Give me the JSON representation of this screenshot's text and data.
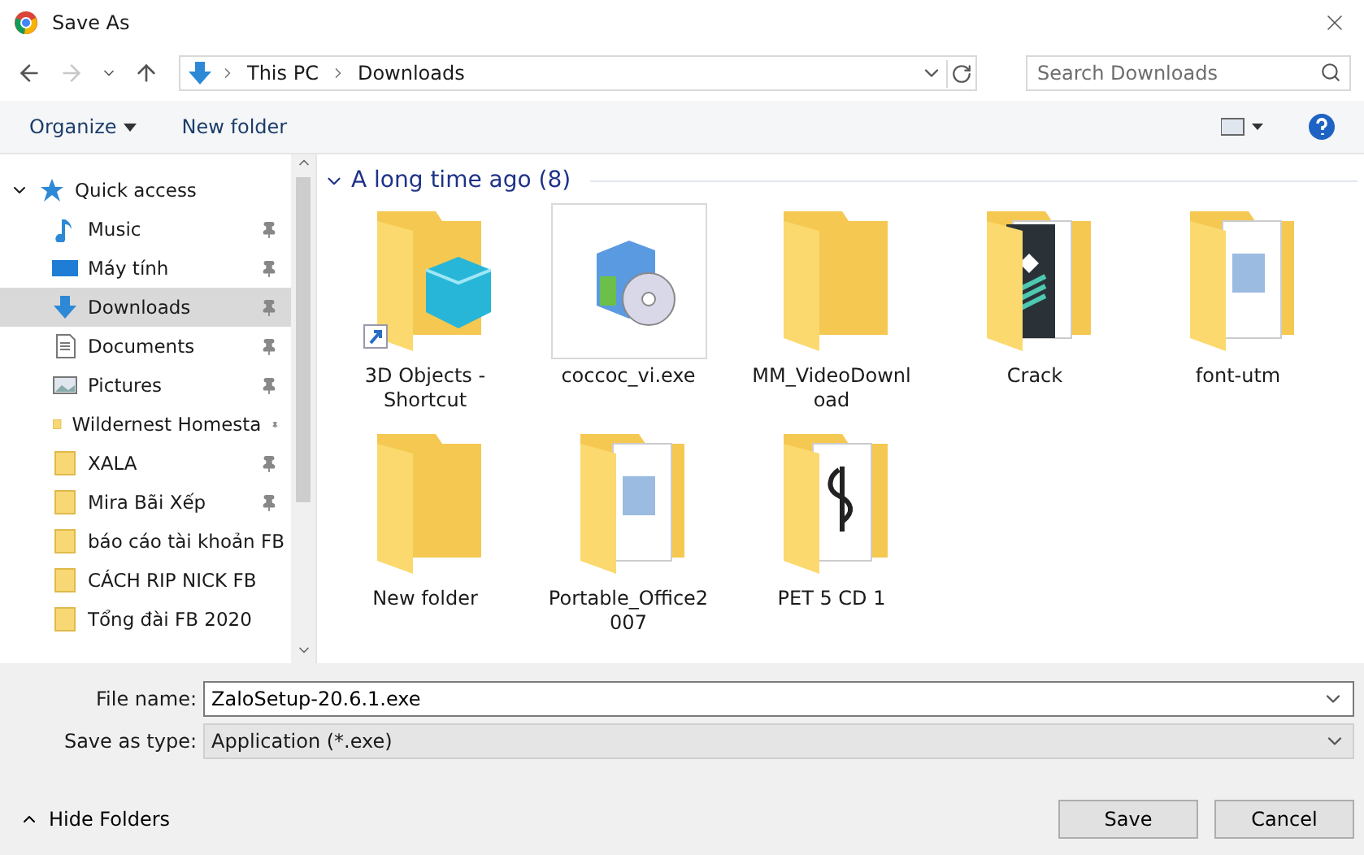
{
  "window": {
    "title": "Save As"
  },
  "address": {
    "path": [
      "This PC",
      "Downloads"
    ]
  },
  "search": {
    "placeholder": "Search Downloads"
  },
  "toolbar": {
    "organize": "Organize",
    "new_folder": "New folder"
  },
  "sidebar": {
    "header": {
      "label": "Quick access",
      "expanded": true
    },
    "items": [
      {
        "label": "Music",
        "kind": "music",
        "pinned": true,
        "selected": false
      },
      {
        "label": "Máy tính",
        "kind": "monitor",
        "pinned": true,
        "selected": false
      },
      {
        "label": "Downloads",
        "kind": "download",
        "pinned": true,
        "selected": true
      },
      {
        "label": "Documents",
        "kind": "document",
        "pinned": true,
        "selected": false
      },
      {
        "label": "Pictures",
        "kind": "picture",
        "pinned": true,
        "selected": false
      },
      {
        "label": "Wildernest Homesta",
        "kind": "folder",
        "pinned": true,
        "selected": false
      },
      {
        "label": "XALA",
        "kind": "folder",
        "pinned": true,
        "selected": false
      },
      {
        "label": "Mira Bãi Xếp",
        "kind": "folder",
        "pinned": true,
        "selected": false
      },
      {
        "label": "báo cáo tài khoản FB",
        "kind": "folder",
        "pinned": false,
        "selected": false
      },
      {
        "label": "CÁCH RIP NICK FB",
        "kind": "folder",
        "pinned": false,
        "selected": false
      },
      {
        "label": "Tổng đài FB 2020",
        "kind": "folder",
        "pinned": false,
        "selected": false
      }
    ]
  },
  "group": {
    "label": "A long time ago (8)",
    "expanded": true
  },
  "files": [
    {
      "name": "3D Objects - Shortcut",
      "kind": "shortcut",
      "selected": false
    },
    {
      "name": "coccoc_vi.exe",
      "kind": "exe",
      "selected": true
    },
    {
      "name": "MM_VideoDownl oad",
      "kind": "folder",
      "selected": false
    },
    {
      "name": "Crack",
      "kind": "folder-dark",
      "selected": false
    },
    {
      "name": "font-utm",
      "kind": "folder-doc",
      "selected": false
    },
    {
      "name": "New folder",
      "kind": "folder",
      "selected": false
    },
    {
      "name": "Portable_Office2 007",
      "kind": "folder-doc",
      "selected": false
    },
    {
      "name": "PET 5 CD 1",
      "kind": "folder-music",
      "selected": false
    }
  ],
  "form": {
    "file_name_label": "File name:",
    "file_name": "ZaloSetup-20.6.1.exe",
    "type_label": "Save as type:",
    "type": "Application (*.exe)"
  },
  "footer": {
    "hide_folders": "Hide Folders",
    "buttons": [
      "Save",
      "Cancel"
    ]
  }
}
